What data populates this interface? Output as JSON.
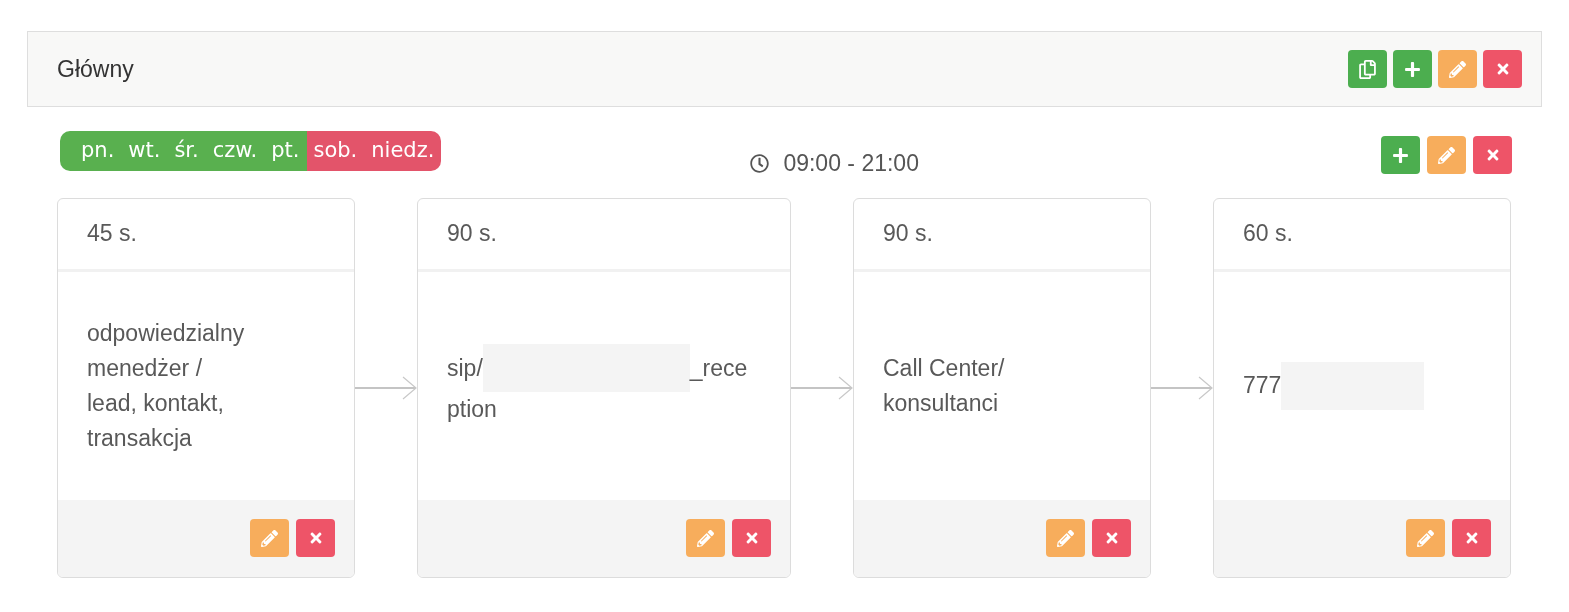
{
  "panel": {
    "title": "Główny"
  },
  "schedule": {
    "days": [
      {
        "label": "pn.",
        "on": true
      },
      {
        "label": "wt.",
        "on": true
      },
      {
        "label": "śr.",
        "on": true
      },
      {
        "label": "czw.",
        "on": true
      },
      {
        "label": "pt.",
        "on": true
      },
      {
        "label": "sob.",
        "on": false
      },
      {
        "label": "niedz.",
        "on": false
      }
    ],
    "time": "09:00 - 21:00"
  },
  "steps": [
    {
      "duration": "45 s.",
      "body": {
        "kind": "text",
        "text": "odpowiedzialny menedżer / lead, kontakt, transakcja"
      }
    },
    {
      "duration": "90 s.",
      "body": {
        "kind": "masked",
        "before": "sip/",
        "after": "_rece",
        "next_line": "ption"
      }
    },
    {
      "duration": "90 s.",
      "body": {
        "kind": "text",
        "text": "Call Center/ konsultanci"
      }
    },
    {
      "duration": "60 s.",
      "body": {
        "kind": "masked",
        "before": "777"
      }
    }
  ]
}
